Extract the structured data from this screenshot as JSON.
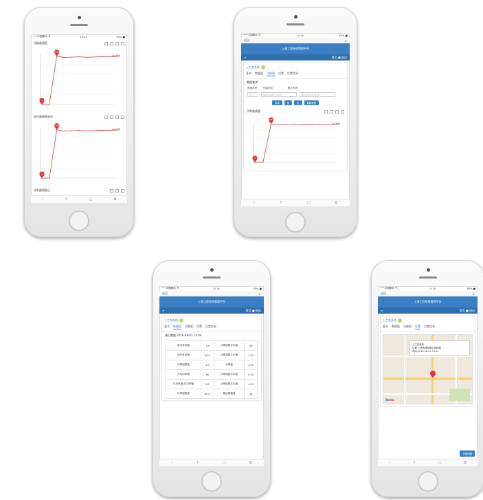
{
  "colors": {
    "accent": "#3a7fc3",
    "chart_line": "#d9393c",
    "marker": "#d9393c"
  },
  "phone1": {
    "status": {
      "left": "•••中国移动 令",
      "time": "14:18",
      "right": "55% ■"
    },
    "charts": [
      {
        "title": "功能曲线图",
        "max_label": "1540",
        "min_label": "0",
        "legend": "数据",
        "chart_data": {
          "type": "line",
          "series": [
            {
              "values": [
                0,
                0,
                1540,
                1500,
                1510,
                1520,
                1505,
                1515,
                1525,
                1520,
                1530
              ]
            }
          ]
        }
      },
      {
        "title": "电压曲线图变化",
        "max_label": "1540",
        "min_label": "0",
        "legend": "数据",
        "chart_data": {
          "type": "line",
          "series": [
            {
              "values": [
                0,
                0,
                1540,
                1500,
                1510,
                1520,
                1505,
                1515,
                1525,
                1520,
                1530
              ]
            }
          ]
        }
      },
      {
        "title": "功率曲线图示"
      }
    ],
    "nav": [
      "‹",
      "↑",
      "□",
      "⧉"
    ]
  },
  "phone2": {
    "status": {
      "left": "•••中国移动 令",
      "time": "14:18",
      "right": "55% ■"
    },
    "top_link": "返回",
    "header_title": "上海工程系统管理平台",
    "subbar": {
      "left": "≡",
      "right": "首页  ■ 退出"
    },
    "card_title": "上工务系统",
    "tabs": [
      "基本",
      "数据值",
      "功能图",
      "位置",
      "位置信息"
    ],
    "section": "数据查询",
    "form_labels": [
      "数据类型",
      "开始时间",
      "截止时间"
    ],
    "inputs": [
      "1/h",
      "2016-08-01 12:00",
      "2016-08-01 14:00"
    ],
    "buttons": [
      "查询",
      "前",
      "后",
      "最新数据"
    ],
    "chart_title": "功率曲线图",
    "chart_data": {
      "type": "line",
      "series": [
        {
          "values": [
            0,
            0,
            1540,
            1500,
            1510,
            1520,
            1505,
            1515,
            1525,
            1520,
            1530
          ]
        }
      ]
    },
    "nav": [
      "‹",
      "↑",
      "□",
      "⧉"
    ]
  },
  "phone3": {
    "status": {
      "left": "•••中国移动 令",
      "time": "14:18",
      "right": "55% ■"
    },
    "top_link": "返回",
    "header_title": "上海工程系统管理平台",
    "subbar": {
      "left": "≡",
      "right": "首页  ■ 退出"
    },
    "card_title": "上工务系统",
    "tabs": [
      "基本",
      "数据值",
      "功能图",
      "位置",
      "位置信息"
    ],
    "table_caption": "最后数据 2016-08-01 14:00",
    "rows": [
      [
        "电流有效值",
        "1/h",
        "功率因数平均值",
        "46"
      ],
      [
        "电压有效值",
        "8h/h",
        "功率因数平均值",
        "1.00"
      ],
      [
        "功率因数值",
        "1/h",
        "功率值",
        "1.00"
      ],
      [
        "无功功率值",
        "8h",
        "功率因数平均值",
        "4.00"
      ],
      [
        "总功率值/总功率值",
        "8/1",
        "功率因数平均值",
        "4.00"
      ],
      [
        "功率因数值",
        "8h/h",
        "最后数据值",
        "46"
      ]
    ],
    "nav": [
      "‹",
      "↑",
      "□",
      "⧉"
    ]
  },
  "phone4": {
    "status": {
      "left": "•••中国移动 令",
      "time": "14:18",
      "right": "55% ■"
    },
    "top_link": "返回",
    "header_title": "上海工程系统管理平台",
    "subbar": {
      "left": "≡",
      "right": "首页  ■ 退出"
    },
    "card_title": "上工务系统",
    "tabs": [
      "基本",
      "数据值",
      "功能图",
      "位置",
      "位置信息"
    ],
    "popup": {
      "title": "上工务系统",
      "line1": "位置:上海市浦东新区张杨路",
      "line2": "时间:2016-08-01 14:00"
    },
    "map_button": "查看地图",
    "nav": [
      "‹",
      "↑",
      "□",
      "⧉"
    ]
  }
}
